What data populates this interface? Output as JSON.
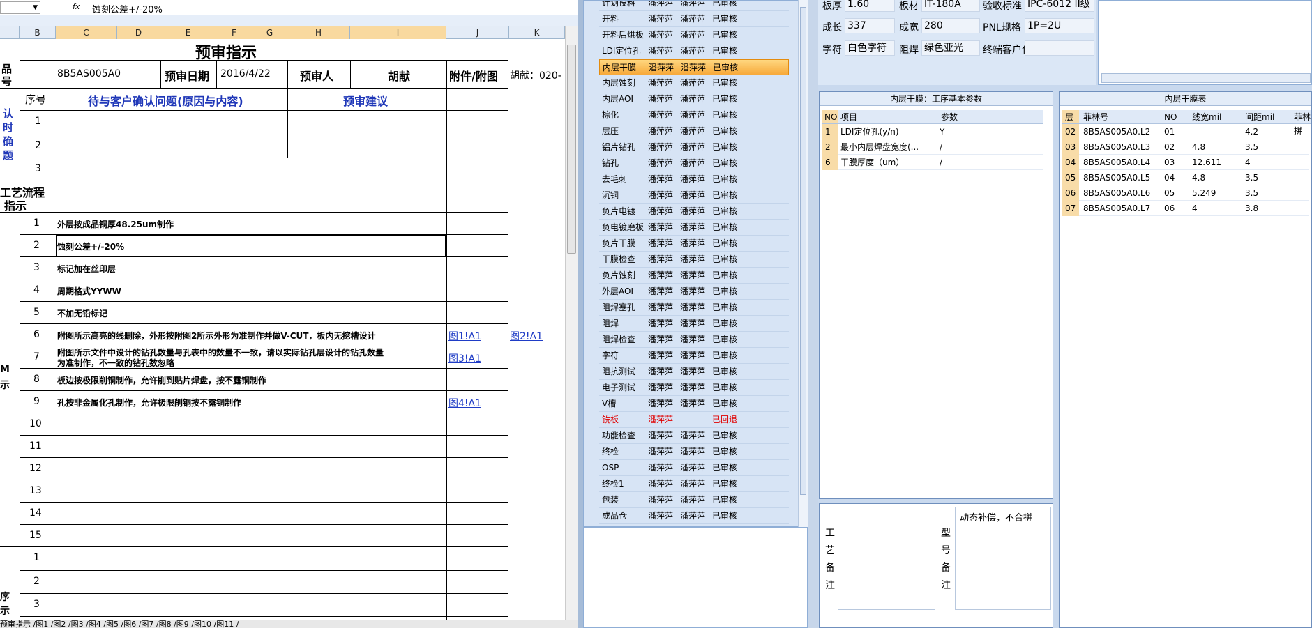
{
  "excel": {
    "name_box": "",
    "fx_label": "fx",
    "formula": "蚀刻公差+/-20%",
    "columns": [
      "B",
      "C",
      "D",
      "E",
      "F",
      "G",
      "H",
      "I",
      "J",
      "K"
    ],
    "title": "预审指示",
    "row1": {
      "label_a": "品",
      "label_b": "号",
      "product_no": "8B5AS005A0",
      "date_label": "预审日期",
      "date": "2016/4/22",
      "reviewer_label": "预审人",
      "reviewer": "胡献",
      "attach_label": "附件/附图",
      "note_k": "胡献：020-"
    },
    "confirm": {
      "side_label": [
        "认",
        "时",
        "确",
        "题"
      ],
      "seq_label": "序号",
      "issue_header": "待与客户确认问题(原因与内容)",
      "advice_header": "预审建议",
      "rows": [
        "1",
        "2",
        "3"
      ]
    },
    "process": {
      "label_1": "工艺流程",
      "label_2": "指示"
    },
    "instructions": [
      {
        "no": "1",
        "text": "外层按成品铜厚48.25um制作",
        "link1": "",
        "link2": ""
      },
      {
        "no": "2",
        "text": "蚀刻公差+/-20%",
        "link1": "",
        "link2": ""
      },
      {
        "no": "3",
        "text": "标记加在丝印层",
        "link1": "",
        "link2": ""
      },
      {
        "no": "4",
        "text": "周期格式YYWW",
        "link1": "",
        "link2": ""
      },
      {
        "no": "5",
        "text": "不加无铅标记",
        "link1": "",
        "link2": ""
      },
      {
        "no": "6",
        "text": "附图所示高亮的线删除，外形按附图2所示外形为准制作并做V-CUT，板内无挖槽设计",
        "link1": "图1!A1",
        "link2": "图2!A1"
      },
      {
        "no": "7",
        "text": "附图所示文件中设计的钻孔数量与孔表中的数量不一致，请以实际钻孔层设计的钻孔数量",
        "text2": "为准制作，不一致的钻孔数忽略",
        "link1": "图3!A1",
        "link2": ""
      },
      {
        "no": "8",
        "text": "板边按极限削铜制作，允许削到贴片焊盘，按不露铜制作",
        "link1": "",
        "link2": ""
      },
      {
        "no": "9",
        "text": "孔按非金属化孔制作，允许极限削铜按不露铜制作",
        "link1": "图4!A1",
        "link2": ""
      },
      {
        "no": "10",
        "text": "",
        "link1": "",
        "link2": ""
      },
      {
        "no": "11",
        "text": "",
        "link1": "",
        "link2": ""
      },
      {
        "no": "12",
        "text": "",
        "link1": "",
        "link2": ""
      },
      {
        "no": "13",
        "text": "",
        "link1": "",
        "link2": ""
      },
      {
        "no": "14",
        "text": "",
        "link1": "",
        "link2": ""
      },
      {
        "no": "15",
        "text": "",
        "link1": "",
        "link2": ""
      }
    ],
    "instr_side": [
      "M",
      "示"
    ],
    "bottom_rows": [
      "1",
      "2",
      "3"
    ],
    "bottom_side": [
      "序",
      "示"
    ],
    "sheet_tabs": "预审指示 /图1 /图2 /图3 /图4 /图5 /图6 /图7 /图8 /图9 /图10 /图11 /"
  },
  "process_list": [
    {
      "step": "计划投料",
      "a": "潘萍萍",
      "b": "潘萍萍",
      "s": "已审核"
    },
    {
      "step": "开料",
      "a": "潘萍萍",
      "b": "潘萍萍",
      "s": "已审核"
    },
    {
      "step": "开料后烘板",
      "a": "潘萍萍",
      "b": "潘萍萍",
      "s": "已审核"
    },
    {
      "step": "LDI定位孔",
      "a": "潘萍萍",
      "b": "潘萍萍",
      "s": "已审核"
    },
    {
      "step": "内层干膜",
      "a": "潘萍萍",
      "b": "潘萍萍",
      "s": "已审核"
    },
    {
      "step": "内层蚀刻",
      "a": "潘萍萍",
      "b": "潘萍萍",
      "s": "已审核"
    },
    {
      "step": "内层AOI",
      "a": "潘萍萍",
      "b": "潘萍萍",
      "s": "已审核"
    },
    {
      "step": "棕化",
      "a": "潘萍萍",
      "b": "潘萍萍",
      "s": "已审核"
    },
    {
      "step": "层压",
      "a": "潘萍萍",
      "b": "潘萍萍",
      "s": "已审核"
    },
    {
      "step": "铝片钻孔",
      "a": "潘萍萍",
      "b": "潘萍萍",
      "s": "已审核"
    },
    {
      "step": "钻孔",
      "a": "潘萍萍",
      "b": "潘萍萍",
      "s": "已审核"
    },
    {
      "step": "去毛刺",
      "a": "潘萍萍",
      "b": "潘萍萍",
      "s": "已审核"
    },
    {
      "step": "沉铜",
      "a": "潘萍萍",
      "b": "潘萍萍",
      "s": "已审核"
    },
    {
      "step": "负片电镀",
      "a": "潘萍萍",
      "b": "潘萍萍",
      "s": "已审核"
    },
    {
      "step": "负电镀磨板",
      "a": "潘萍萍",
      "b": "潘萍萍",
      "s": "已审核"
    },
    {
      "step": "负片干膜",
      "a": "潘萍萍",
      "b": "潘萍萍",
      "s": "已审核"
    },
    {
      "step": "干膜检查",
      "a": "潘萍萍",
      "b": "潘萍萍",
      "s": "已审核"
    },
    {
      "step": "负片蚀刻",
      "a": "潘萍萍",
      "b": "潘萍萍",
      "s": "已审核"
    },
    {
      "step": "外层AOI",
      "a": "潘萍萍",
      "b": "潘萍萍",
      "s": "已审核"
    },
    {
      "step": "阻焊塞孔",
      "a": "潘萍萍",
      "b": "潘萍萍",
      "s": "已审核"
    },
    {
      "step": "阻焊",
      "a": "潘萍萍",
      "b": "潘萍萍",
      "s": "已审核"
    },
    {
      "step": "阻焊检查",
      "a": "潘萍萍",
      "b": "潘萍萍",
      "s": "已审核"
    },
    {
      "step": "字符",
      "a": "潘萍萍",
      "b": "潘萍萍",
      "s": "已审核"
    },
    {
      "step": "阻抗测试",
      "a": "潘萍萍",
      "b": "潘萍萍",
      "s": "已审核"
    },
    {
      "step": "电子测试",
      "a": "潘萍萍",
      "b": "潘萍萍",
      "s": "已审核"
    },
    {
      "step": "V槽",
      "a": "潘萍萍",
      "b": "潘萍萍",
      "s": "已审核"
    },
    {
      "step": "铣板",
      "a": "潘萍萍",
      "b": "",
      "s": "已回退"
    },
    {
      "step": "功能检查",
      "a": "潘萍萍",
      "b": "潘萍萍",
      "s": "已审核"
    },
    {
      "step": "终检",
      "a": "潘萍萍",
      "b": "潘萍萍",
      "s": "已审核"
    },
    {
      "step": "OSP",
      "a": "潘萍萍",
      "b": "潘萍萍",
      "s": "已审核"
    },
    {
      "step": "终检1",
      "a": "潘萍萍",
      "b": "潘萍萍",
      "s": "已审核"
    },
    {
      "step": "包装",
      "a": "潘萍萍",
      "b": "潘萍萍",
      "s": "已审核"
    },
    {
      "step": "成品仓",
      "a": "潘萍萍",
      "b": "潘萍萍",
      "s": "已审核"
    }
  ],
  "basic": {
    "thickness_label": "板厚",
    "thickness": "1.60",
    "material_label": "板材",
    "material": "IT-180A",
    "standard_label": "验收标准",
    "standard": "IPC-6012 II级",
    "len_label": "成长",
    "len": "337",
    "width_label": "成宽",
    "width": "280",
    "pnl_label": "PNL规格",
    "pnl": "1P=2U",
    "char_label": "字符",
    "char": "白色字符",
    "mask_label": "阻焊",
    "mask": "绿色亚光",
    "customer_label": "终端客户代码",
    "customer": ""
  },
  "params": {
    "title": "内层干膜：工序基本参数",
    "headers": [
      "NO",
      "项目",
      "参数"
    ],
    "rows": [
      {
        "no": "1",
        "item": "LDI定位孔(y/n)",
        "val": "Y"
      },
      {
        "no": "2",
        "item": "最小内层焊盘宽度(...",
        "val": "/"
      },
      {
        "no": "6",
        "item": "干膜厚度（um）",
        "val": "/"
      }
    ]
  },
  "films": {
    "title": "内层干膜表",
    "headers": [
      "层",
      "菲林号",
      "NO",
      "线宽mil",
      "间距mil",
      "菲林拼"
    ],
    "rows": [
      {
        "layer": "02",
        "film": "8B5AS005A0.L2",
        "no": "01",
        "lw": "",
        "sp": "4.2"
      },
      {
        "layer": "03",
        "film": "8B5AS005A0.L3",
        "no": "02",
        "lw": "4.8",
        "sp": "3.5"
      },
      {
        "layer": "04",
        "film": "8B5AS005A0.L4",
        "no": "03",
        "lw": "12.611",
        "sp": "4"
      },
      {
        "layer": "05",
        "film": "8B5AS005A0.L5",
        "no": "04",
        "lw": "4.8",
        "sp": "3.5"
      },
      {
        "layer": "06",
        "film": "8B5AS005A0.L6",
        "no": "05",
        "lw": "5.249",
        "sp": "3.5"
      },
      {
        "layer": "07",
        "film": "8B5AS005A0.L7",
        "no": "06",
        "lw": "4",
        "sp": "3.8"
      }
    ]
  },
  "notes": {
    "process_label": [
      "工",
      "艺",
      "备",
      "注"
    ],
    "process_note": "",
    "model_label": [
      "型",
      "号",
      "备",
      "注"
    ],
    "model_note": "动态补偿，不合拼"
  },
  "colors": {
    "selected_row": "#f7a93a",
    "reverted": "#e00000",
    "panel_bg": "#d7e4f5"
  }
}
